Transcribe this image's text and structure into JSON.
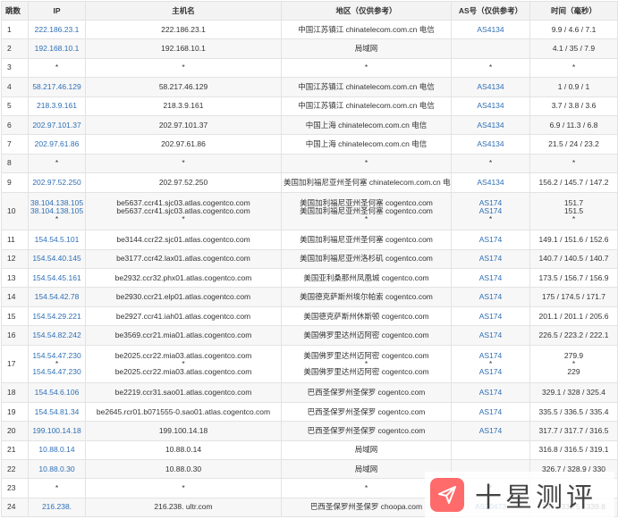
{
  "headers": {
    "hop": "跳数",
    "ip": "IP",
    "host": "主机名",
    "region": "地区（仅供参考）",
    "as": "AS号（仅供参考）",
    "time": "时间（毫秒）"
  },
  "rows": [
    {
      "hop": "1",
      "ip": [
        "222.186.23.1"
      ],
      "host": [
        "222.186.23.1"
      ],
      "region": [
        "中国江苏镇江 chinatelecom.com.cn 电信"
      ],
      "as": [
        "AS4134"
      ],
      "time": [
        "9.9 / 4.6 / 7.1"
      ]
    },
    {
      "hop": "2",
      "ip": [
        "192.168.10.1"
      ],
      "host": [
        "192.168.10.1"
      ],
      "region": [
        "局域网"
      ],
      "as": [
        ""
      ],
      "time": [
        "4.1 / 35 / 7.9"
      ]
    },
    {
      "hop": "3",
      "ip": [
        "*"
      ],
      "host": [
        "*"
      ],
      "region": [
        "*"
      ],
      "as": [
        "*"
      ],
      "time": [
        "*"
      ]
    },
    {
      "hop": "4",
      "ip": [
        "58.217.46.129"
      ],
      "host": [
        "58.217.46.129"
      ],
      "region": [
        "中国江苏镇江 chinatelecom.com.cn 电信"
      ],
      "as": [
        "AS4134"
      ],
      "time": [
        "1 / 0.9 / 1"
      ]
    },
    {
      "hop": "5",
      "ip": [
        "218.3.9.161"
      ],
      "host": [
        "218.3.9.161"
      ],
      "region": [
        "中国江苏镇江 chinatelecom.com.cn 电信"
      ],
      "as": [
        "AS4134"
      ],
      "time": [
        "3.7 / 3.8 / 3.6"
      ]
    },
    {
      "hop": "6",
      "ip": [
        "202.97.101.37"
      ],
      "host": [
        "202.97.101.37"
      ],
      "region": [
        "中国上海 chinatelecom.com.cn 电信"
      ],
      "as": [
        "AS4134"
      ],
      "time": [
        "6.9 / 11.3 / 6.8"
      ]
    },
    {
      "hop": "7",
      "ip": [
        "202.97.61.86"
      ],
      "host": [
        "202.97.61.86"
      ],
      "region": [
        "中国上海 chinatelecom.com.cn 电信"
      ],
      "as": [
        "AS4134"
      ],
      "time": [
        "21.5 / 24 / 23.2"
      ]
    },
    {
      "hop": "8",
      "ip": [
        "*"
      ],
      "host": [
        "*"
      ],
      "region": [
        "*"
      ],
      "as": [
        "*"
      ],
      "time": [
        "*"
      ]
    },
    {
      "hop": "9",
      "ip": [
        "202.97.52.250"
      ],
      "host": [
        "202.97.52.250"
      ],
      "region": [
        "美国加利福尼亚州圣何塞 chinatelecom.com.cn 电信"
      ],
      "as": [
        "AS4134"
      ],
      "time": [
        "156.2 / 145.7 / 147.2"
      ]
    },
    {
      "hop": "10",
      "ip": [
        "38.104.138.105",
        "38.104.138.105",
        "*"
      ],
      "host": [
        "be5637.ccr41.sjc03.atlas.cogentco.com",
        "be5637.ccr41.sjc03.atlas.cogentco.com",
        "*"
      ],
      "region": [
        "美国加利福尼亚州圣何塞 cogentco.com",
        "美国加利福尼亚州圣何塞 cogentco.com",
        "*"
      ],
      "as": [
        "AS174",
        "AS174",
        "*"
      ],
      "time": [
        "151.7",
        "151.5",
        "*"
      ]
    },
    {
      "hop": "11",
      "ip": [
        "154.54.5.101"
      ],
      "host": [
        "be3144.ccr22.sjc01.atlas.cogentco.com"
      ],
      "region": [
        "美国加利福尼亚州圣何塞 cogentco.com"
      ],
      "as": [
        "AS174"
      ],
      "time": [
        "149.1 / 151.6 / 152.6"
      ]
    },
    {
      "hop": "12",
      "ip": [
        "154.54.40.145"
      ],
      "host": [
        "be3177.ccr42.lax01.atlas.cogentco.com"
      ],
      "region": [
        "美国加利福尼亚州洛杉矶 cogentco.com"
      ],
      "as": [
        "AS174"
      ],
      "time": [
        "140.7 / 140.5 / 140.7"
      ]
    },
    {
      "hop": "13",
      "ip": [
        "154.54.45.161"
      ],
      "host": [
        "be2932.ccr32.phx01.atlas.cogentco.com"
      ],
      "region": [
        "美国亚利桑那州凤凰城 cogentco.com"
      ],
      "as": [
        "AS174"
      ],
      "time": [
        "173.5 / 156.7 / 156.9"
      ]
    },
    {
      "hop": "14",
      "ip": [
        "154.54.42.78"
      ],
      "host": [
        "be2930.ccr21.elp01.atlas.cogentco.com"
      ],
      "region": [
        "美国德克萨斯州埃尔帕索 cogentco.com"
      ],
      "as": [
        "AS174"
      ],
      "time": [
        "175 / 174.5 / 171.7"
      ]
    },
    {
      "hop": "15",
      "ip": [
        "154.54.29.221"
      ],
      "host": [
        "be2927.ccr41.iah01.atlas.cogentco.com"
      ],
      "region": [
        "美国德克萨斯州休斯顿 cogentco.com"
      ],
      "as": [
        "AS174"
      ],
      "time": [
        "201.1 / 201.1 / 205.6"
      ]
    },
    {
      "hop": "16",
      "ip": [
        "154.54.82.242"
      ],
      "host": [
        "be3569.ccr21.mia01.atlas.cogentco.com"
      ],
      "region": [
        "美国佛罗里达州迈阿密 cogentco.com"
      ],
      "as": [
        "AS174"
      ],
      "time": [
        "226.5 / 223.2 / 222.1"
      ]
    },
    {
      "hop": "17",
      "ip": [
        "154.54.47.230",
        "*",
        "154.54.47.230"
      ],
      "host": [
        "be2025.ccr22.mia03.atlas.cogentco.com",
        "*",
        "be2025.ccr22.mia03.atlas.cogentco.com"
      ],
      "region": [
        "美国佛罗里达州迈阿密 cogentco.com",
        "*",
        "美国佛罗里达州迈阿密 cogentco.com"
      ],
      "as": [
        "AS174",
        "*",
        "AS174"
      ],
      "time": [
        "279.9",
        "*",
        "229"
      ]
    },
    {
      "hop": "18",
      "ip": [
        "154.54.6.106"
      ],
      "host": [
        "be2219.ccr31.sao01.atlas.cogentco.com"
      ],
      "region": [
        "巴西圣保罗州圣保罗 cogentco.com"
      ],
      "as": [
        "AS174"
      ],
      "time": [
        "329.1 / 328 / 325.4"
      ]
    },
    {
      "hop": "19",
      "ip": [
        "154.54.81.34"
      ],
      "host": [
        "be2645.rcr01.b071555-0.sao01.atlas.cogentco.com"
      ],
      "region": [
        "巴西圣保罗州圣保罗 cogentco.com"
      ],
      "as": [
        "AS174"
      ],
      "time": [
        "335.5 / 336.5 / 335.4"
      ]
    },
    {
      "hop": "20",
      "ip": [
        "199.100.14.18"
      ],
      "host": [
        "199.100.14.18"
      ],
      "region": [
        "巴西圣保罗州圣保罗 cogentco.com"
      ],
      "as": [
        "AS174"
      ],
      "time": [
        "317.7 / 317.7 / 316.5"
      ]
    },
    {
      "hop": "21",
      "ip": [
        "10.88.0.14"
      ],
      "host": [
        "10.88.0.14"
      ],
      "region": [
        "局域网"
      ],
      "as": [
        ""
      ],
      "time": [
        "316.8 / 316.5 / 319.1"
      ]
    },
    {
      "hop": "22",
      "ip": [
        "10.88.0.30"
      ],
      "host": [
        "10.88.0.30"
      ],
      "region": [
        "局域网"
      ],
      "as": [
        ""
      ],
      "time": [
        "326.7 / 328.9 / 330"
      ]
    },
    {
      "hop": "23",
      "ip": [
        "*"
      ],
      "host": [
        "*"
      ],
      "region": [
        "*"
      ],
      "as": [
        "*"
      ],
      "time": [
        "*"
      ]
    },
    {
      "hop": "24",
      "ip": [
        "216.238."
      ],
      "host": [
        "216.238.          ultr.com"
      ],
      "region": [
        "巴西圣保罗州圣保罗 choopa.com"
      ],
      "as": [
        "AS20473"
      ],
      "time": [
        "336 / 339.5 / 339.8"
      ]
    }
  ],
  "watermark": {
    "text": "十星测评"
  },
  "colors": {
    "link": "#2f6fb5",
    "header_bg": "#f3f3f3",
    "stripe_bg": "#f7f7f7",
    "border": "#e3e3e3",
    "logo_bg": "#ff6b6b"
  }
}
